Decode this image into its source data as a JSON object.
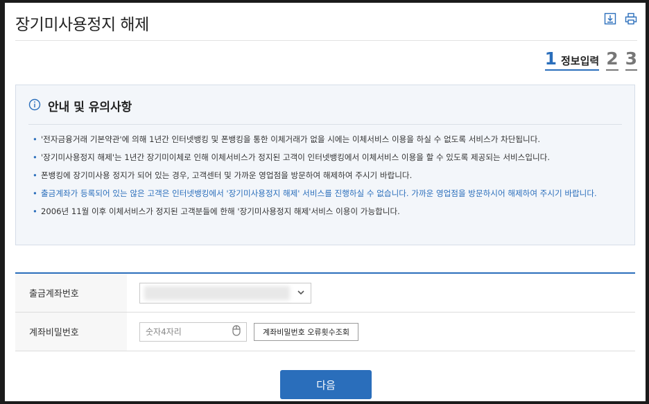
{
  "page": {
    "title": "장기미사용정지 해제"
  },
  "toolbar": {
    "icons": [
      "download-icon",
      "print-icon"
    ]
  },
  "steps": {
    "active_number": "1",
    "active_label": "정보입력",
    "step2": "2",
    "step3": "3"
  },
  "notice": {
    "title": "안내 및 유의사항",
    "items": [
      "'전자금융거래 기본약관'에 의해 1년간 인터넷뱅킹 및 폰뱅킹을 통한 이체거래가 없을 시에는 이체서비스 이용을 하실 수 없도록 서비스가 차단됩니다.",
      "'장기미사용정지 해제'는 1년간 장기미이체로 인해 이체서비스가 정지된 고객이 인터넷뱅킹에서 이체서비스 이용을 할 수 있도록 제공되는 서비스입니다.",
      "폰뱅킹에 장기미사용 정지가 되어 있는 경우, 고객센터 및 가까운 영업점을 방문하여 해제하여 주시기 바랍니다.",
      "출금계좌가 등록되어 있는 않은 고객은 인터넷뱅킹에서 '장기미사용정지 해제' 서비스를 진행하실 수 없습니다. 가까운 영업점을 방문하시어 해제하여 주시기 바랍니다.",
      "2006년 11월 이후 이체서비스가 정지된 고객분들에 한해 '장기미사용정지 해제'서비스 이용이 가능합니다."
    ]
  },
  "form": {
    "account_label": "출금계좌번호",
    "password_label": "계좌비밀번호",
    "password_placeholder": "숫자4자리",
    "error_check_button": "계좌비밀번호 오류횟수조회"
  },
  "actions": {
    "next_label": "다음"
  },
  "colors": {
    "accent": "#2a6ebb"
  }
}
